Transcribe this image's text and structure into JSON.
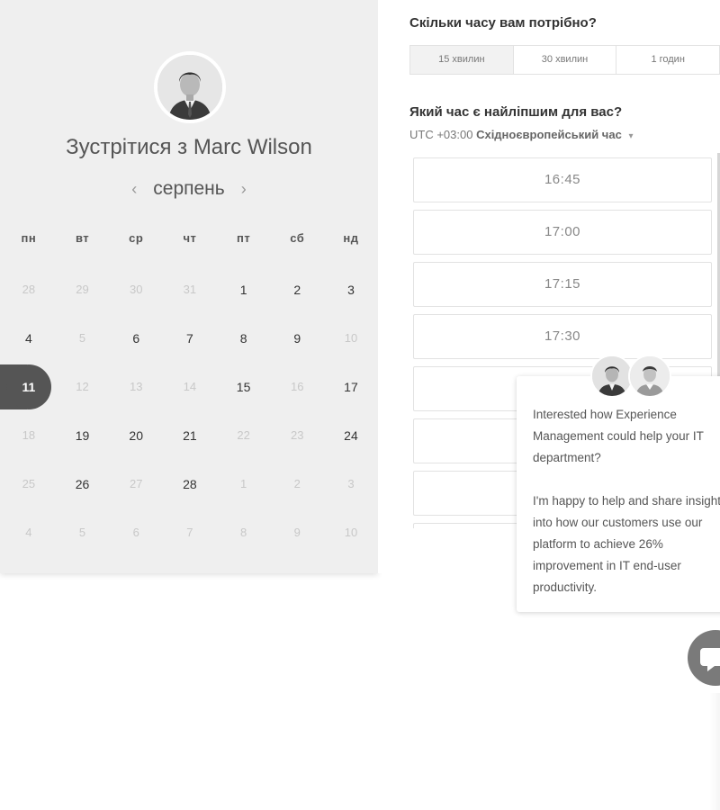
{
  "calendar": {
    "title_prefix": "Зустрітися з",
    "host_name": "Marc Wilson",
    "month": "серпень",
    "prev_arrow": "‹",
    "next_arrow": "›",
    "weekdays": [
      "пн",
      "вт",
      "ср",
      "чт",
      "пт",
      "сб",
      "нд"
    ],
    "weeks": [
      [
        {
          "d": "28",
          "s": "dim"
        },
        {
          "d": "29",
          "s": "dim"
        },
        {
          "d": "30",
          "s": "dim"
        },
        {
          "d": "31",
          "s": "dim"
        },
        {
          "d": "1",
          "s": "avail"
        },
        {
          "d": "2",
          "s": "avail"
        },
        {
          "d": "3",
          "s": "avail"
        }
      ],
      [
        {
          "d": "4",
          "s": "avail"
        },
        {
          "d": "5",
          "s": "dim"
        },
        {
          "d": "6",
          "s": "avail"
        },
        {
          "d": "7",
          "s": "avail"
        },
        {
          "d": "8",
          "s": "avail"
        },
        {
          "d": "9",
          "s": "avail"
        },
        {
          "d": "10",
          "s": "dim"
        }
      ],
      [
        {
          "d": "11",
          "s": "selected"
        },
        {
          "d": "12",
          "s": "dim"
        },
        {
          "d": "13",
          "s": "dim"
        },
        {
          "d": "14",
          "s": "dim"
        },
        {
          "d": "15",
          "s": "avail"
        },
        {
          "d": "16",
          "s": "dim"
        },
        {
          "d": "17",
          "s": "avail"
        }
      ],
      [
        {
          "d": "18",
          "s": "dim"
        },
        {
          "d": "19",
          "s": "avail"
        },
        {
          "d": "20",
          "s": "avail"
        },
        {
          "d": "21",
          "s": "avail"
        },
        {
          "d": "22",
          "s": "dim"
        },
        {
          "d": "23",
          "s": "dim"
        },
        {
          "d": "24",
          "s": "avail"
        }
      ],
      [
        {
          "d": "25",
          "s": "dim"
        },
        {
          "d": "26",
          "s": "avail"
        },
        {
          "d": "27",
          "s": "dim"
        },
        {
          "d": "28",
          "s": "avail"
        },
        {
          "d": "1",
          "s": "dim"
        },
        {
          "d": "2",
          "s": "dim"
        },
        {
          "d": "3",
          "s": "dim"
        }
      ],
      [
        {
          "d": "4",
          "s": "dim"
        },
        {
          "d": "5",
          "s": "dim"
        },
        {
          "d": "6",
          "s": "dim"
        },
        {
          "d": "7",
          "s": "dim"
        },
        {
          "d": "8",
          "s": "dim"
        },
        {
          "d": "9",
          "s": "dim"
        },
        {
          "d": "10",
          "s": "dim"
        }
      ]
    ]
  },
  "booking": {
    "duration_question": "Скільки часу вам потрібно?",
    "durations": [
      "15 хвилин",
      "30 хвилин",
      "1 годин"
    ],
    "active_duration": 0,
    "time_question": "Який час є найліпшим для вас?",
    "timezone_offset": "UTC +03:00",
    "timezone_name": "Східноєвропейський час",
    "timezone_caret": "▾",
    "slots": [
      "16:45",
      "17:00",
      "17:15",
      "17:30",
      "",
      "",
      "",
      ""
    ]
  },
  "chat": {
    "message_1": "Interested how Experience Management could help your IT department?",
    "message_2": "I'm happy to help and share insight into how our customers use our platform to achieve 26% improvement in IT end-user productivity."
  }
}
